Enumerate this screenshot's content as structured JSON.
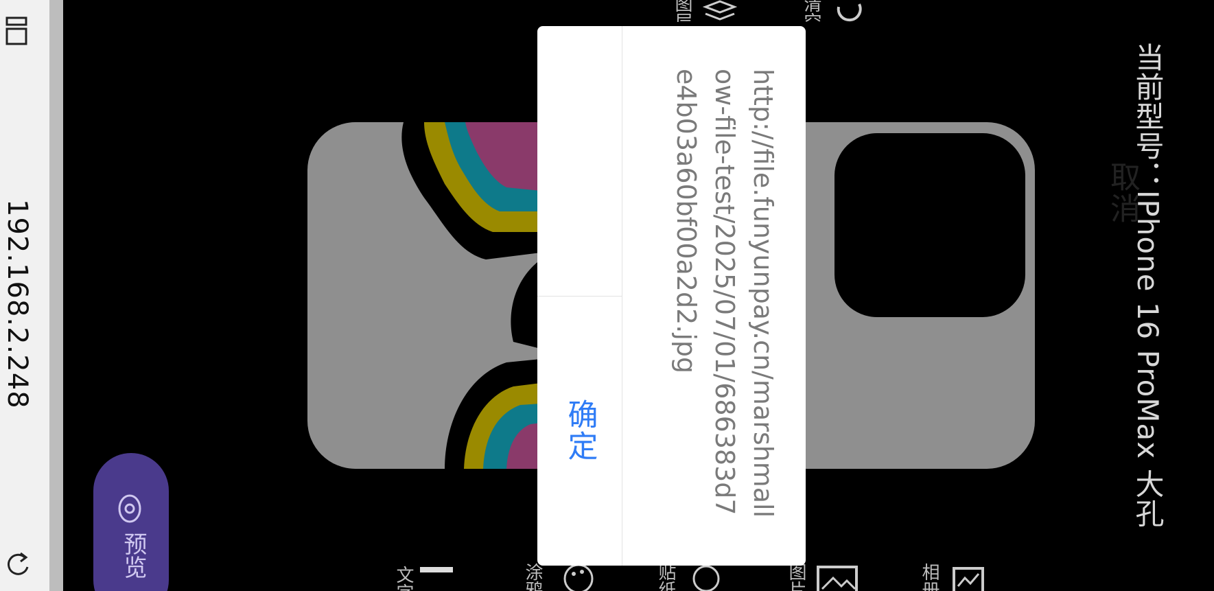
{
  "browser": {
    "address": "192.168.2.248"
  },
  "header": {
    "model_label": "当前型号：IPhone 16 ProMax 大孔"
  },
  "toolbar_top": {
    "item1_label": "图层",
    "item2_label": "清空"
  },
  "toolbar_bottom": {
    "text_label": "文字",
    "doodle_label": "涂鸦",
    "sticker_label": "贴纸",
    "image_label": "图片",
    "album_label": "相册"
  },
  "preview": {
    "label": "预览"
  },
  "dialog": {
    "message": "http://file.funyunpay.cn/marshmallow-file-test/2025/07/01/686383d7e4b03a60bf00a2d2.jpg",
    "cancel_label": "取消",
    "confirm_label": "确定"
  },
  "colors": {
    "accent_blue": "#2f7cf6",
    "preview_purple": "#4a3a8c",
    "case_gray": "#8f8f8f",
    "artwork_yellow": "#9a8a00",
    "artwork_teal": "#0e7a8a",
    "artwork_magenta": "#8a3a6a"
  }
}
